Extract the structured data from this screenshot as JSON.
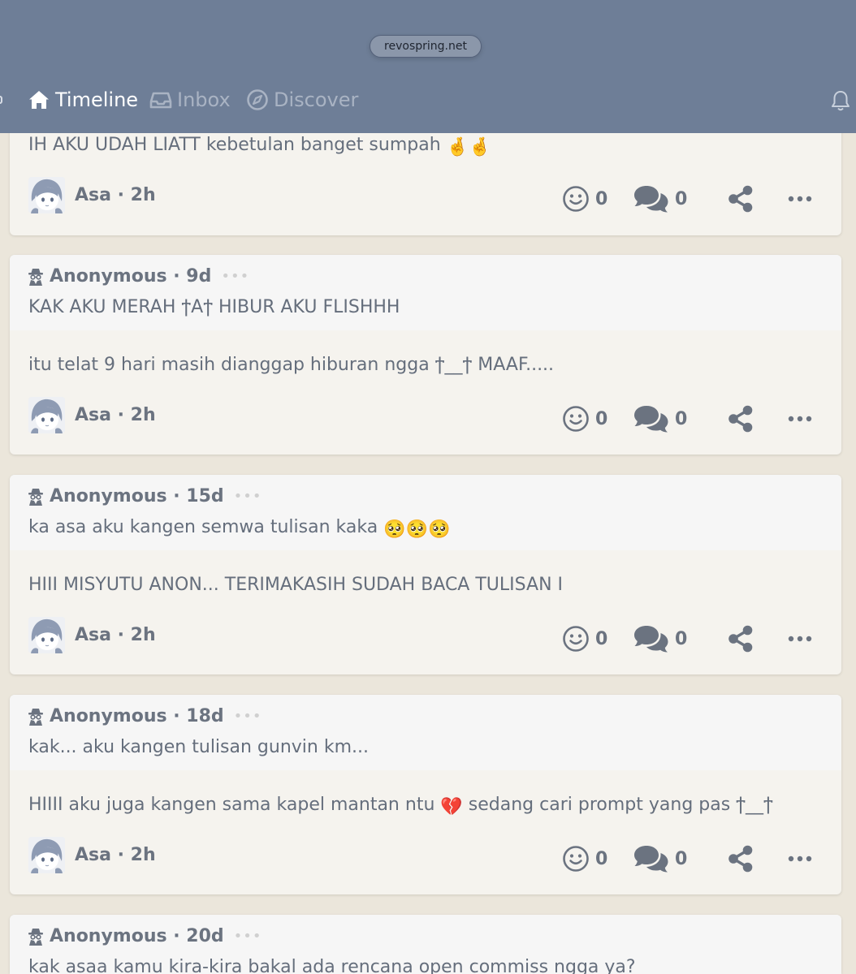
{
  "header": {
    "url": "revospring.net",
    "nav": {
      "timeline": "Timeline",
      "inbox": "Inbox",
      "discover": "Discover"
    }
  },
  "icons": {
    "timeline": "home-icon",
    "inbox": "inbox-icon",
    "discover": "compass-icon",
    "notifications": "bell-icon",
    "anonymous": "spy-icon",
    "smile": "smile-icon",
    "comments": "comments-icon",
    "share": "share-icon",
    "more": "ellipsis-icon"
  },
  "colors": {
    "header_bg": "#6e7e97",
    "page_bg": "#ebe6db",
    "card_bg": "#f5f3ee",
    "question_bg": "#f6f6f6",
    "text": "#656e7c"
  },
  "posts": [
    {
      "answer": "IH AKU UDAH LIATT kebetulan banget sumpah",
      "answer_emoji": "🤞🤞",
      "author": "Asa · 2h",
      "smiles": "0",
      "comments": "0"
    },
    {
      "asker": "Anonymous · 9d",
      "question": "KAK AKU MERAH ϯAϯ HIBUR AKU FLISHHH",
      "answer": "itu telat 9 hari masih dianggap hiburan ngga ϯ__ϯ MAAF.....",
      "author": "Asa · 2h",
      "smiles": "0",
      "comments": "0"
    },
    {
      "asker": "Anonymous · 15d",
      "question": "ka asa aku kangen semwa tulisan kaka",
      "question_emoji": "🥺🥺🥺",
      "answer": "HIII MISYUTU ANON... TERIMAKASIH SUDAH BACA TULISAN I",
      "author": "Asa · 2h",
      "smiles": "0",
      "comments": "0"
    },
    {
      "asker": "Anonymous · 18d",
      "question": "kak... aku kangen tulisan gunvin km...",
      "answer_before": "HIIII aku juga kangen sama kapel mantan ntu",
      "answer_emoji": "💔",
      "answer_after": "sedang cari prompt yang pas ϯ__ϯ",
      "author": "Asa · 2h",
      "smiles": "0",
      "comments": "0"
    },
    {
      "asker": "Anonymous · 20d",
      "question": "kak asaa kamu kira-kira bakal ada rencana open commiss ngga ya?"
    }
  ]
}
